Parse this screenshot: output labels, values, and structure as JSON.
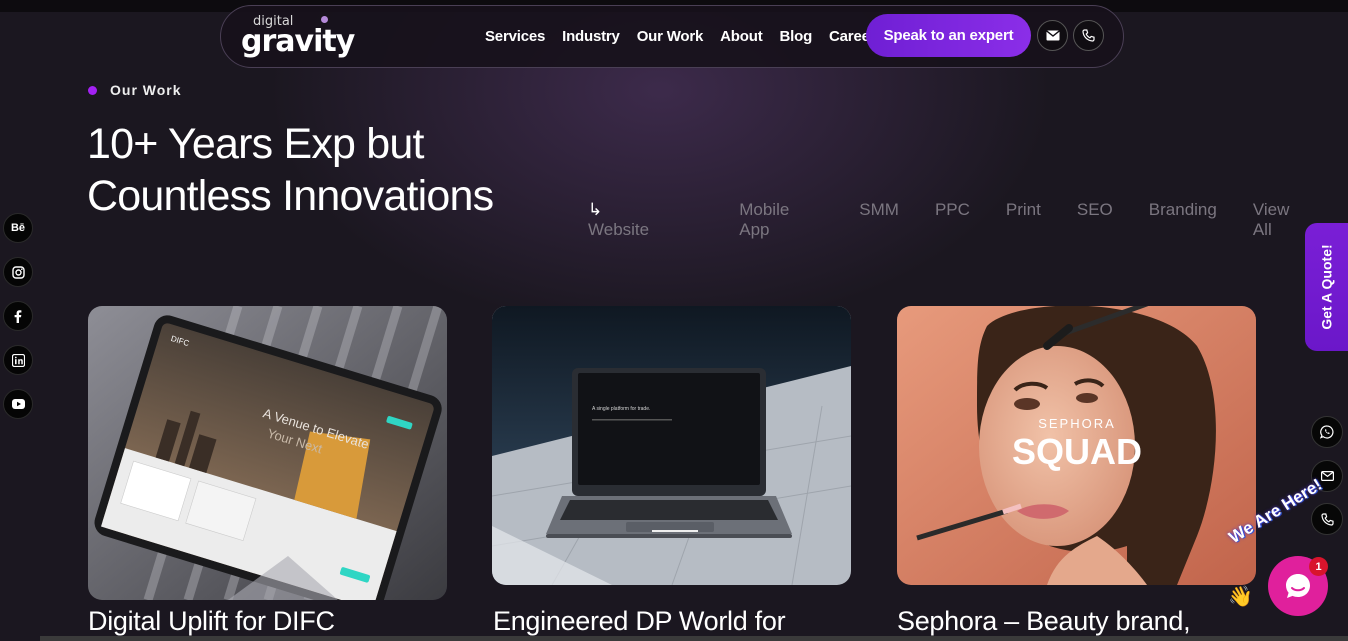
{
  "header": {
    "logo_small": "digital",
    "logo_big": "gravity",
    "menu": [
      "Services",
      "Industry",
      "Our Work",
      "About",
      "Blog",
      "Career"
    ],
    "cta": "Speak to an expert",
    "icons": [
      "mail-icon",
      "phone-icon"
    ]
  },
  "section": {
    "eyebrow": "Our Work",
    "headline_line1": "10+ Years Exp but",
    "headline_line2": "Countless Innovations"
  },
  "filters": {
    "active": "Website",
    "items": [
      "Mobile App",
      "SMM",
      "PPC",
      "Print",
      "SEO",
      "Branding",
      "View All"
    ]
  },
  "social": {
    "behance": "Bē",
    "icons": [
      "behance-icon",
      "instagram-icon",
      "facebook-icon",
      "linkedin-icon",
      "youtube-icon"
    ]
  },
  "right_rail": {
    "quote_label": "Get A Quote!",
    "icons": [
      "whatsapp-icon",
      "mail-icon",
      "phone-icon"
    ]
  },
  "cards": [
    {
      "title": "Digital Uplift for DIFC",
      "image_text_1": "A Venue to Elevate",
      "image_text_2": "Your Next",
      "image_brand": "DIFC"
    },
    {
      "title": "Engineered DP World for",
      "image_text_1": "A single platform for trade."
    },
    {
      "title": "Sephora – Beauty brand,",
      "image_text_1": "SEPHORA",
      "image_text_2": "SQUAD"
    }
  ],
  "chat": {
    "label": "We Are Here!",
    "badge": "1"
  },
  "colors": {
    "accent": "#8b2ee8",
    "background": "#1b1720",
    "chat": "#e0209c"
  }
}
